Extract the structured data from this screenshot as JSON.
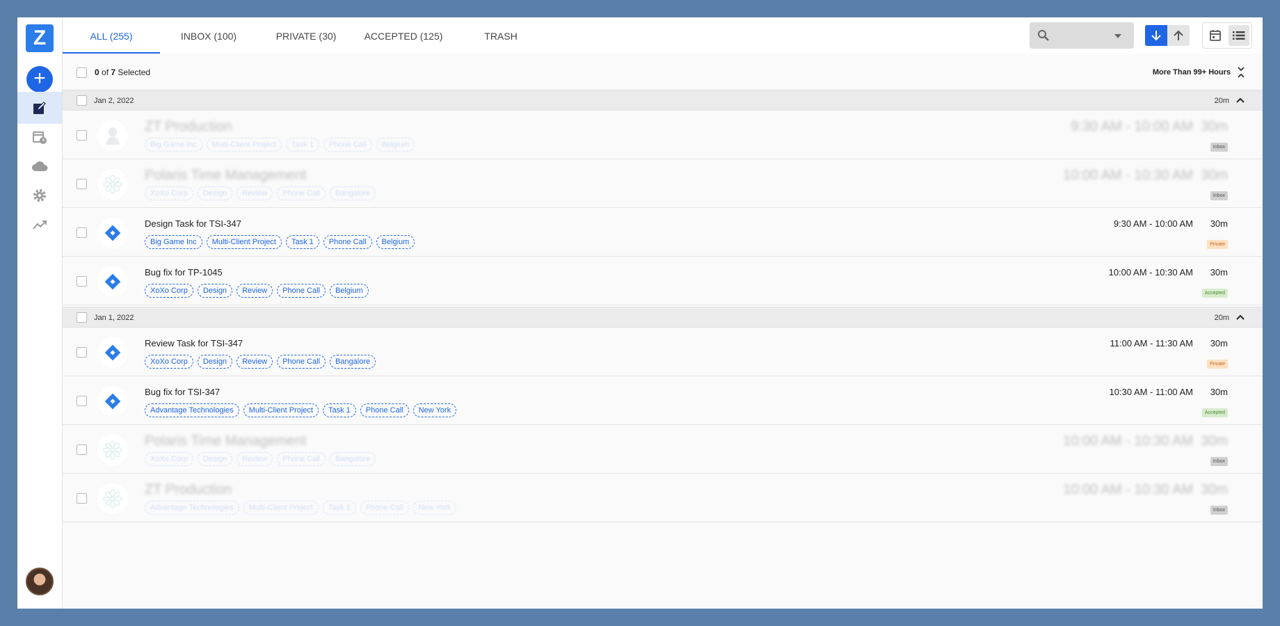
{
  "tabs": [
    {
      "label": "ALL (255)"
    },
    {
      "label": "INBOX (100)"
    },
    {
      "label": "PRIVATE (30)"
    },
    {
      "label": "ACCEPTED (125)"
    },
    {
      "label": "TRASH"
    }
  ],
  "logo": {
    "letter": "Z"
  },
  "add_button": {
    "symbol": "+"
  },
  "selection": {
    "count": "0",
    "of_text": " of ",
    "total": "7",
    "suffix": " Selected"
  },
  "hours_filter": {
    "label": "More Than 99+ Hours"
  },
  "groups": [
    {
      "date": "Jan 2, 2022",
      "total": "20m",
      "entries": [
        {
          "title": "ZT Production",
          "tags": [
            "Big Game Inc",
            "Multi-Client Project",
            "Task 1",
            "Phone Call",
            "Belgium"
          ],
          "time": "9:30 AM - 10:00 AM",
          "duration": "30m",
          "status": "Inbox",
          "icon": "bust-icon"
        },
        {
          "title": "Polaris Time Management",
          "tags": [
            "XoXo Corp",
            "Design",
            "Review",
            "Phone Call",
            "Bangalore"
          ],
          "time": "10:00 AM - 10:30 AM",
          "duration": "30m",
          "status": "Inbox",
          "icon": "flower-icon"
        },
        {
          "title": "Design Task for TSI-347",
          "tags": [
            "Big Game Inc",
            "Multi-Client Project",
            "Task 1",
            "Phone Call",
            "Belgium"
          ],
          "time": "9:30 AM - 10:00 AM",
          "duration": "30m",
          "status": "Private",
          "icon": "jira-icon"
        },
        {
          "title": "Bug fix for TP-1045",
          "tags": [
            "XoXo Corp",
            "Design",
            "Review",
            "Phone Call",
            "Belgium"
          ],
          "time": "10:00 AM - 10:30 AM",
          "duration": "30m",
          "status": "Accepted",
          "icon": "jira-icon"
        }
      ]
    },
    {
      "date": "Jan 1, 2022",
      "total": "20m",
      "entries": [
        {
          "title": "Review Task for TSI-347",
          "tags": [
            "XoXo Corp",
            "Design",
            "Review",
            "Phone Call",
            "Bangalore"
          ],
          "time": "11:00 AM - 11:30 AM",
          "duration": "30m",
          "status": "Private",
          "icon": "jira-icon"
        },
        {
          "title": "Bug fix for TSI-347",
          "tags": [
            "Advantage Technologies",
            "Multi-Client Project",
            "Task 1",
            "Phone Call",
            "New York"
          ],
          "time": "10:30 AM - 11:00 AM",
          "duration": "30m",
          "status": "Accepted",
          "icon": "jira-icon"
        },
        {
          "title": "Polaris Time Management",
          "tags": [
            "XoXo Corp",
            "Design",
            "Review",
            "Phone Call",
            "Bangalore"
          ],
          "time": "10:00 AM - 10:30 AM",
          "duration": "30m",
          "status": "Inbox",
          "icon": "flower-icon"
        },
        {
          "title": "ZT Production",
          "tags": [
            "Advantage Technologies",
            "Multi-Client Project",
            "Task 1",
            "Phone Call",
            "New York"
          ],
          "time": "10:00 AM - 10:30 AM",
          "duration": "30m",
          "status": "Inbox",
          "icon": "flower-icon"
        }
      ]
    }
  ],
  "colors": {
    "accent": "#1f66e5",
    "brand": "#2b7de9",
    "background": "#5a7fa8"
  },
  "icons": [
    "logo-icon",
    "plus-icon",
    "timesheet-icon",
    "calendar-clock-icon",
    "cloud-icon",
    "gear-icon",
    "analytics-icon",
    "search-icon",
    "chevron-down-icon",
    "arrow-down-icon",
    "arrow-up-icon",
    "calendar-icon",
    "list-icon"
  ]
}
